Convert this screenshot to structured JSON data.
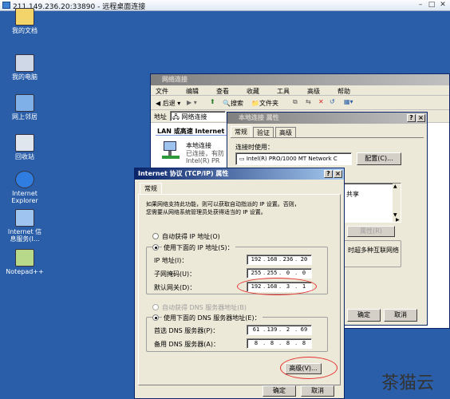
{
  "rdp": {
    "title": "211.149.236.20:33890 - 远程桌面连接"
  },
  "desktop": {
    "icons": [
      {
        "label": "我的文档",
        "icon": "folder-icon"
      },
      {
        "label": "我的电脑",
        "icon": "computer-icon"
      },
      {
        "label": "网上邻居",
        "icon": "network-icon"
      },
      {
        "label": "回收站",
        "icon": "recycle-bin-icon"
      },
      {
        "label": "Internet\nExplorer",
        "icon": "ie-icon"
      },
      {
        "label": "Internet 信\n息服务(I...",
        "icon": "iis-icon"
      },
      {
        "label": "Notepad++",
        "icon": "notepad-icon"
      }
    ]
  },
  "netconn": {
    "title": "网络连接",
    "menu": [
      "文件",
      "编辑",
      "查看",
      "收藏",
      "工具",
      "高级",
      "帮助"
    ],
    "toolbar": {
      "back": "后退",
      "search": "搜索",
      "folders": "文件夹"
    },
    "address_label": "地址",
    "address_value": "网络连接",
    "section": "LAN 或高速 Internet",
    "item": {
      "line1": "本地连接",
      "line2": "已连接，有防",
      "line3": "Intel(R) PR"
    }
  },
  "lanprops": {
    "title": "本地连接 属性",
    "tabs": [
      "常规",
      "验证",
      "高级"
    ],
    "connect_using": "连接时使用：",
    "adapter": "Intel(R) PRO/1000 MT Network C",
    "configure": "配置(C)...",
    "share": "共享",
    "props_btn": "属性(R)",
    "notify": "时超多种互联网络",
    "ok": "确定",
    "cancel": "取消"
  },
  "tcpip": {
    "title": "Internet 协议 (TCP/IP) 属性",
    "tab": "常规",
    "desc1": "如果网络支持此功能，则可以获取自动指派的 IP 设置。否则，",
    "desc2": "您需要从网络系统管理员处获得适当的 IP 设置。",
    "auto_ip": "自动获得 IP 地址(O)",
    "manual_ip": "使用下面的 IP 地址(S)：",
    "ip_label": "IP 地址(I)：",
    "ip": [
      "192",
      "168",
      "236",
      "20"
    ],
    "mask_label": "子网掩码(U)：",
    "mask": [
      "255",
      "255",
      "0",
      "0"
    ],
    "gw_label": "默认网关(D)：",
    "gw": [
      "192",
      "168",
      "3",
      "1"
    ],
    "auto_dns": "自动获得 DNS 服务器地址(B)",
    "manual_dns": "使用下面的 DNS 服务器地址(E)：",
    "dns1_label": "首选 DNS 服务器(P)：",
    "dns1": [
      "61",
      "139",
      "2",
      "69"
    ],
    "dns2_label": "备用 DNS 服务器(A)：",
    "dns2": [
      "8",
      "8",
      "8",
      "8"
    ],
    "advanced": "高级(V)...",
    "ok": "确定",
    "cancel": "取消"
  },
  "watermark": "茶猫云",
  "colors": {
    "desktop": "#2a5ea8",
    "title_active": "#0a246a",
    "highlight_oval": "#e53030"
  }
}
